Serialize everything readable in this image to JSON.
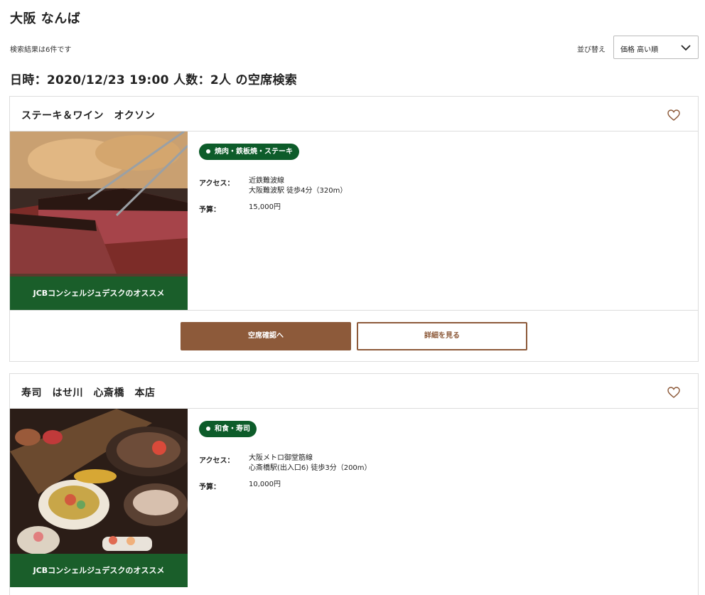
{
  "header": {
    "area_title": "大阪 なんば",
    "result_count": "検索結果は6件です",
    "sort_label": "並び替え",
    "sort_value": "価格 高い順",
    "search_condition": "日時：2020/12/23 19:00 人数：2人 の空席検索"
  },
  "colors": {
    "accent": "#8d5a3a",
    "tag_green": "#0d5c2a",
    "reco_green": "#1a5e2a"
  },
  "restaurants": [
    {
      "name": "ステーキ＆ワイン　オクソン",
      "recommend": "JCBコンシェルジュデスクのオススメ",
      "tag": "焼肉・鉄板焼・ステーキ",
      "access_label": "アクセス：",
      "access_line1": "近鉄難波線",
      "access_line2": "大阪難波駅 徒歩4分（320m）",
      "budget_label": "予算：",
      "budget": "15,000円",
      "availability_button": "空席確認へ",
      "detail_button": "詳細を見る"
    },
    {
      "name": "寿司　はせ川　心斎橋　本店",
      "recommend": "JCBコンシェルジュデスクのオススメ",
      "tag": "和食・寿司",
      "access_label": "アクセス：",
      "access_line1": "大阪メトロ御堂筋線",
      "access_line2": "心斎橋駅(出入口6) 徒歩3分（200m）",
      "budget_label": "予算：",
      "budget": "10,000円"
    }
  ]
}
